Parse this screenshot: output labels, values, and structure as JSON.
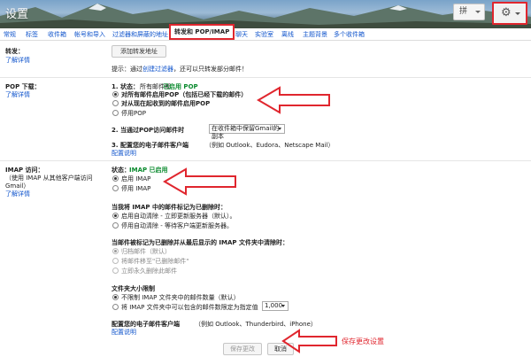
{
  "header": {
    "title": "设置",
    "lang_label": "拼",
    "gear_glyph": "⚙"
  },
  "tabs": [
    {
      "label": "常规"
    },
    {
      "label": "标签"
    },
    {
      "label": "收件箱"
    },
    {
      "label": "帐号和导入"
    },
    {
      "label": "过滤器和屏蔽的地址"
    },
    {
      "label": "转发和 POP/IMAP"
    },
    {
      "label": "聊天"
    },
    {
      "label": "实验室"
    },
    {
      "label": "离线"
    },
    {
      "label": "主题背景"
    },
    {
      "label": "多个收件箱"
    }
  ],
  "forwarding": {
    "heading": "转发：",
    "learn_more": "了解详情",
    "add_button": "添加转发地址",
    "tip_prefix": "提示：通过",
    "tip_link": "创建过滤器",
    "tip_suffix": "，还可以只转发部分邮件！"
  },
  "pop": {
    "heading": "POP 下载：",
    "learn_more": "了解详情",
    "status_label": "1. 状态：",
    "status_prefix": "所有邮件都",
    "status_value": "已启用 POP",
    "options": [
      {
        "label": "对所有邮件启用POP（包括已经下载的邮件）",
        "selected": true
      },
      {
        "label": "对从现在起收到的邮件启用POP",
        "selected": false
      },
      {
        "label": "停用POP",
        "selected": false
      }
    ],
    "step2_label": "2. 当通过POP访问邮件时",
    "step2_select": "在收件箱中保留Gmail的副本",
    "step3_label": "3. 配置您的电子邮件客户端",
    "step3_hint": "（例如 Outlook、Eudora、Netscape Mail）",
    "step3_link": "配置说明"
  },
  "imap": {
    "heading": "IMAP 访问：",
    "sub1": "（使用 IMAP 从其他客户端访问",
    "sub2": "Gmail）",
    "learn_more": "了解详情",
    "status_label": "状态：",
    "status_value": "IMAP 已启用",
    "options": [
      {
        "label": "启用 IMAP",
        "selected": true
      },
      {
        "label": "停用 IMAP",
        "selected": false
      }
    ],
    "deleted_heading": "当我将 IMAP 中的邮件标记为已删除时：",
    "deleted_options": [
      {
        "label": "启用自动清除 - 立即更新服务器（默认）。",
        "selected": true
      },
      {
        "label": "停用自动清除 - 等待客户端更新服务器。",
        "selected": false
      }
    ],
    "expunged_heading": "当邮件被标记为已删除并从最后显示的 IMAP 文件夹中清除时：",
    "expunged_options": [
      {
        "label": "归档邮件（默认）",
        "selected": true
      },
      {
        "label": "将邮件移至\"已删除邮件\"",
        "selected": false
      },
      {
        "label": "立即永久删除此邮件",
        "selected": false
      }
    ],
    "folder_heading": "文件夹大小限制",
    "folder_options": [
      {
        "label": "不限制 IMAP 文件夹中的邮件数量（默认）",
        "selected": true
      },
      {
        "label": "将 IMAP 文件夹中可以包含的邮件数限定为指定值",
        "selected": false
      }
    ],
    "folder_select": "1,000",
    "client_heading": "配置您的电子邮件客户端",
    "client_hint": "（例如 Outlook、Thunderbird、iPhone）",
    "client_link": "配置说明"
  },
  "footer": {
    "save_button": "保存更改",
    "cancel_button": "取消",
    "annotation": "保存更改设置"
  },
  "colors": {
    "accent_red": "#e0262e",
    "link_blue": "#1155cc",
    "status_green": "#0a8a2e"
  }
}
